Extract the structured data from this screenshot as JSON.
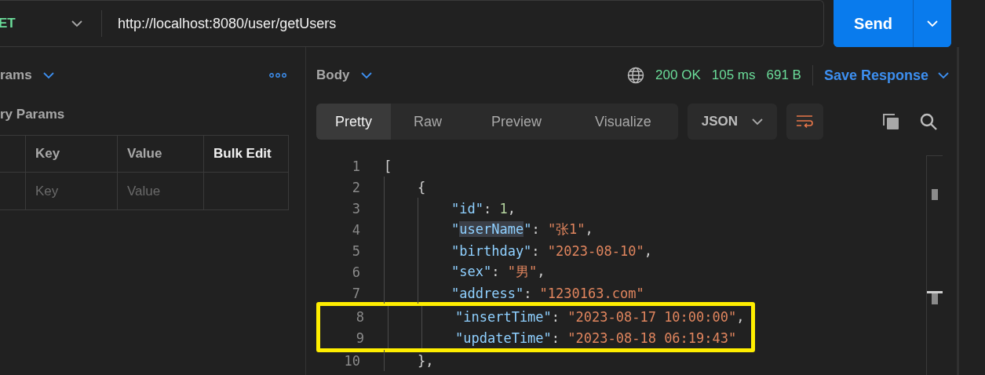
{
  "request": {
    "method": "ET",
    "url": "http://localhost:8080/user/getUsers",
    "send": "Send"
  },
  "params_panel": {
    "title": "rams",
    "section": "ry Params",
    "columns": [
      "Key",
      "Value",
      "Bulk Edit"
    ],
    "placeholders": [
      "Key",
      "Value"
    ]
  },
  "response": {
    "view": "Body",
    "status": "200 OK",
    "time": "105 ms",
    "size": "691 B",
    "save": "Save Response",
    "tabs": [
      {
        "label": "Pretty",
        "selected": true
      },
      {
        "label": "Raw",
        "selected": false
      },
      {
        "label": "Preview",
        "selected": false
      },
      {
        "label": "Visualize",
        "selected": false
      }
    ],
    "format": "JSON",
    "code": [
      {
        "number": "1",
        "boxed": false,
        "tokens": [
          {
            "kind": "punct",
            "text": "["
          }
        ],
        "children": [
          {
            "number": "2",
            "boxed": false,
            "tokens": [
              {
                "kind": "punct",
                "text": "{"
              }
            ],
            "children": [
              {
                "number": "3",
                "boxed": false,
                "tokens": [
                  {
                    "kind": "key",
                    "text": "\"id\""
                  },
                  {
                    "kind": "punct",
                    "text": ": "
                  },
                  {
                    "kind": "num",
                    "text": "1"
                  },
                  {
                    "kind": "punct",
                    "text": ","
                  }
                ]
              },
              {
                "number": "4",
                "boxed": false,
                "tokens": [
                  {
                    "kind": "punct-key",
                    "text": "\""
                  },
                  {
                    "kind": "key-highlight",
                    "text": "userName"
                  },
                  {
                    "kind": "punct-key",
                    "text": "\""
                  },
                  {
                    "kind": "punct",
                    "text": ": "
                  },
                  {
                    "kind": "str",
                    "text": "\"张1\""
                  },
                  {
                    "kind": "punct",
                    "text": ","
                  }
                ]
              },
              {
                "number": "5",
                "boxed": false,
                "tokens": [
                  {
                    "kind": "key",
                    "text": "\"birthday\""
                  },
                  {
                    "kind": "punct",
                    "text": ": "
                  },
                  {
                    "kind": "str",
                    "text": "\"2023-08-10\""
                  },
                  {
                    "kind": "punct",
                    "text": ","
                  }
                ]
              },
              {
                "number": "6",
                "boxed": false,
                "tokens": [
                  {
                    "kind": "key",
                    "text": "\"sex\""
                  },
                  {
                    "kind": "punct",
                    "text": ": "
                  },
                  {
                    "kind": "str",
                    "text": "\"男\""
                  },
                  {
                    "kind": "punct",
                    "text": ","
                  }
                ]
              },
              {
                "number": "7",
                "boxed": false,
                "tokens": [
                  {
                    "kind": "key",
                    "text": "\"address\""
                  },
                  {
                    "kind": "punct",
                    "text": ": "
                  },
                  {
                    "kind": "str",
                    "text": "\"1230163.com\""
                  }
                ]
              },
              {
                "number": "8",
                "boxed": true,
                "tokens": [
                  {
                    "kind": "key",
                    "text": "\"insertTime\""
                  },
                  {
                    "kind": "punct",
                    "text": ": "
                  },
                  {
                    "kind": "str",
                    "text": "\"2023-08-17 10:00:00\""
                  },
                  {
                    "kind": "punct",
                    "text": ","
                  }
                ]
              },
              {
                "number": "9",
                "boxed": true,
                "tokens": [
                  {
                    "kind": "key",
                    "text": "\"updateTime\""
                  },
                  {
                    "kind": "punct",
                    "text": ": "
                  },
                  {
                    "kind": "str",
                    "text": "\"2023-08-18 06:19:43\""
                  }
                ]
              }
            ]
          },
          {
            "number": "10",
            "boxed": false,
            "tokens": [
              {
                "kind": "punct",
                "text": "},"
              }
            ]
          }
        ]
      }
    ]
  }
}
